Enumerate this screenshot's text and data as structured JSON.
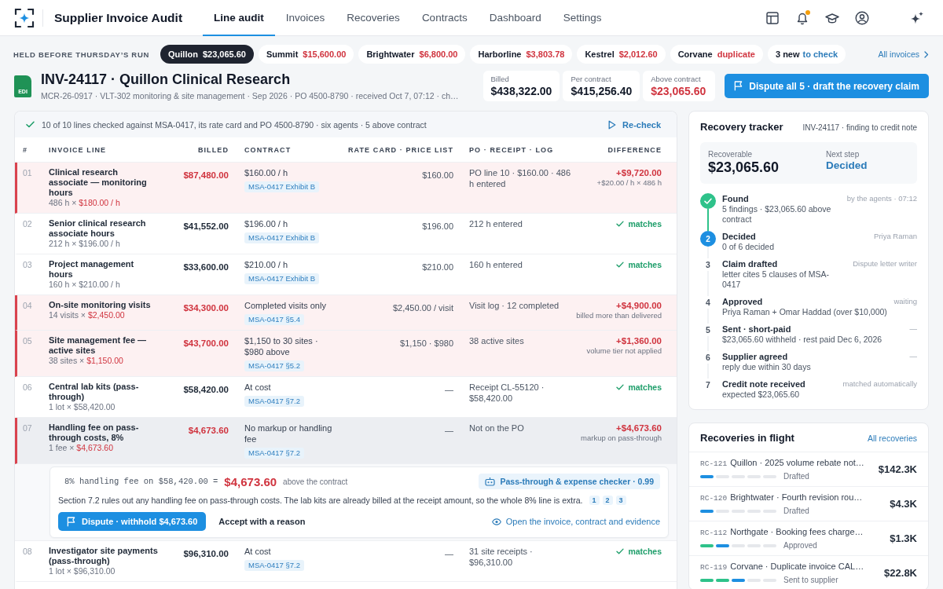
{
  "nav": {
    "title": "Supplier Invoice Audit",
    "tabs": [
      {
        "label": "Line audit",
        "selected": true
      },
      {
        "label": "Invoices",
        "selected": false
      },
      {
        "label": "Recoveries",
        "selected": false
      },
      {
        "label": "Contracts",
        "selected": false
      },
      {
        "label": "Dashboard",
        "selected": false
      },
      {
        "label": "Settings",
        "selected": false
      }
    ],
    "unread_alerts": true
  },
  "held": {
    "label": "HELD BEFORE THURSDAY’S RUN",
    "chips": [
      {
        "vendor": "Quillon",
        "amount": "$23,065.60",
        "selected": true
      },
      {
        "vendor": "Summit",
        "amount": "$15,600.00",
        "selected": false
      },
      {
        "vendor": "Brightwater",
        "amount": "$6,800.00",
        "selected": false
      },
      {
        "vendor": "Harborline",
        "amount": "$3,803.78",
        "selected": false
      },
      {
        "vendor": "Kestrel",
        "amount": "$2,012.60",
        "selected": false
      },
      {
        "vendor": "Corvane",
        "amount": "duplicate",
        "selected": false
      }
    ],
    "new_items": {
      "count": "3 new",
      "action": "to check"
    },
    "link": "All invoices"
  },
  "invoice": {
    "format": "EDI",
    "title": "INV-24117 · Quillon Clinical Research",
    "details": "MCR-26-0917 · VLT-302 monitoring & site management · Sep 2026 · PO 4500-8790 · received Oct 7, 07:12 · ch…",
    "stats": [
      {
        "label": "Billed",
        "value": "$438,322.00",
        "alert": false
      },
      {
        "label": "Per contract",
        "value": "$415,256.40",
        "alert": false
      },
      {
        "label": "Above contract",
        "value": "$23,065.60",
        "alert": true
      }
    ],
    "action": "Dispute all 5 · draft the recovery claim"
  },
  "audit": {
    "summary": "10 of 10 lines checked against MSA-0417, its rate card and PO 4500-8790 · six agents · 5 above contract",
    "recheck": "Re-check",
    "columns": [
      "#",
      "INVOICE LINE",
      "BILLED",
      "CONTRACT",
      "RATE CARD · PRICE LIST",
      "PO · RECEIPT · LOG",
      "DIFFERENCE"
    ],
    "lines": [
      {
        "number": "01",
        "name": "Clinical research associate — monitoring hours",
        "quantity": "486 h ×",
        "rate": "$180.00 / h",
        "billed": "$87,480.00",
        "contract": "$160.00 / h",
        "clause": "MSA-0417 Exhibit B",
        "rate_card": "$160.00",
        "evidence": "PO line 10 · $160.00 · 486 h entered",
        "flagged": true,
        "selected": false,
        "difference": {
          "kind": "above",
          "amount": "+$9,720.00",
          "note": "+$20.00 / h × 486 h"
        }
      },
      {
        "number": "02",
        "name": "Senior clinical research associate hours",
        "quantity": "212 h ×",
        "rate": "$196.00 / h",
        "billed": "$41,552.00",
        "contract": "$196.00 / h",
        "clause": "MSA-0417 Exhibit B",
        "rate_card": "$196.00",
        "evidence": "212 h entered",
        "flagged": false,
        "selected": false,
        "difference": {
          "kind": "match",
          "label": "matches"
        }
      },
      {
        "number": "03",
        "name": "Project management hours",
        "quantity": "160 h ×",
        "rate": "$210.00 / h",
        "billed": "$33,600.00",
        "contract": "$210.00 / h",
        "clause": "MSA-0417 Exhibit B",
        "rate_card": "$210.00",
        "evidence": "160 h entered",
        "flagged": false,
        "selected": false,
        "difference": {
          "kind": "match",
          "label": "matches"
        }
      },
      {
        "number": "04",
        "name": "On-site monitoring visits",
        "quantity": "14 visits ×",
        "rate": "$2,450.00",
        "billed": "$34,300.00",
        "contract": "Completed visits only",
        "clause": "MSA-0417 §5.4",
        "rate_card": "$2,450.00 / visit",
        "evidence": "Visit log · 12 completed",
        "flagged": true,
        "selected": false,
        "difference": {
          "kind": "above",
          "amount": "+$4,900.00",
          "note": "billed more than delivered"
        }
      },
      {
        "number": "05",
        "name": "Site management fee — active sites",
        "quantity": "38 sites ×",
        "rate": "$1,150.00",
        "billed": "$43,700.00",
        "contract": "$1,150 to 30 sites · $980 above",
        "clause": "MSA-0417 §5.2",
        "rate_card": "$1,150 · $980",
        "evidence": "38 active sites",
        "flagged": true,
        "selected": false,
        "difference": {
          "kind": "above",
          "amount": "+$1,360.00",
          "note": "volume tier not applied"
        }
      },
      {
        "number": "06",
        "name": "Central lab kits (pass-through)",
        "quantity": "1 lot ×",
        "rate": "$58,420.00",
        "billed": "$58,420.00",
        "contract": "At cost",
        "clause": "MSA-0417 §7.2",
        "rate_card": "—",
        "evidence": "Receipt CL-55120 · $58,420.00",
        "flagged": false,
        "selected": false,
        "difference": {
          "kind": "match",
          "label": "matches"
        }
      },
      {
        "number": "07",
        "name": "Handling fee on pass-through costs, 8%",
        "quantity": "1 fee ×",
        "rate": "$4,673.60",
        "billed": "$4,673.60",
        "contract": "No markup or handling fee",
        "clause": "MSA-0417 §7.2",
        "rate_card": "—",
        "evidence": "Not on the PO",
        "flagged": true,
        "selected": true,
        "difference": {
          "kind": "above",
          "amount": "+$4,673.60",
          "note": "markup on pass-through"
        },
        "detail": {
          "formula": "8% handling fee on $58,420.00 =",
          "amount": "$4,673.60",
          "note": "above the contract",
          "agent": "Pass-through & expense checker · 0.99",
          "explanation": "Section 7.2 rules out any handling fee on pass-through costs. The lab kits are already billed at the receipt amount, so the whole 8% line is extra.",
          "citations": [
            "1",
            "2",
            "3"
          ],
          "dispute": "Dispute · withhold $4,673.60",
          "accept": "Accept with a reason",
          "evidence_link": "Open the invoice, contract and evidence"
        }
      },
      {
        "number": "08",
        "name": "Investigator site payments (pass-through)",
        "quantity": "1 lot ×",
        "rate": "$96,310.00",
        "billed": "$96,310.00",
        "contract": "At cost",
        "clause": "MSA-0417 §7.2",
        "rate_card": "—",
        "evidence": "31 site receipts · $96,310.00",
        "flagged": false,
        "selected": false,
        "difference": {
          "kind": "match",
          "label": "matches"
        }
      }
    ]
  },
  "tracker": {
    "title": "Recovery tracker",
    "subtitle": "INV-24117 · finding to credit note",
    "recoverable_label": "Recoverable",
    "recoverable": "$23,065.60",
    "next_label": "Next step",
    "next": "Decided",
    "steps": [
      {
        "done": true,
        "current": false,
        "title": "Found",
        "detail": "5 findings · $23,065.60 above contract",
        "meta": "by the agents · 07:12"
      },
      {
        "done": false,
        "current": true,
        "number": "2",
        "title": "Decided",
        "detail": "0 of 6 decided",
        "meta": "Priya Raman"
      },
      {
        "done": false,
        "current": false,
        "number": "3",
        "title": "Claim drafted",
        "detail": "letter cites 5 clauses of MSA-0417",
        "meta": "Dispute letter writer"
      },
      {
        "done": false,
        "current": false,
        "number": "4",
        "title": "Approved",
        "detail": "Priya Raman + Omar Haddad (over $10,000)",
        "meta": "waiting"
      },
      {
        "done": false,
        "current": false,
        "number": "5",
        "title": "Sent · short-paid",
        "detail": "$23,065.60 withheld · rest paid Dec 6, 2026",
        "meta": "—"
      },
      {
        "done": false,
        "current": false,
        "number": "6",
        "title": "Supplier agreed",
        "detail": "reply due within 30 days",
        "meta": "—"
      },
      {
        "done": false,
        "current": false,
        "number": "7",
        "title": "Credit note received",
        "detail": "expected $23,065.60",
        "meta": "matched automatically"
      }
    ]
  },
  "recoveries": {
    "title": "Recoveries in flight",
    "link": "All recoveries",
    "items": [
      {
        "id": "RC-121",
        "title": "Quillon · 2025 volume rebate not…",
        "segments": [
          {
            "done": false,
            "current": true
          },
          {
            "done": false,
            "current": false
          },
          {
            "done": false,
            "current": false
          },
          {
            "done": false,
            "current": false
          },
          {
            "done": false,
            "current": false
          }
        ],
        "status": "Drafted",
        "amount": "$142.3K"
      },
      {
        "id": "RC-120",
        "title": "Brightwater · Fourth revision rou…",
        "segments": [
          {
            "done": false,
            "current": true
          },
          {
            "done": false,
            "current": false
          },
          {
            "done": false,
            "current": false
          },
          {
            "done": false,
            "current": false
          },
          {
            "done": false,
            "current": false
          }
        ],
        "status": "Drafted",
        "amount": "$4.3K"
      },
      {
        "id": "RC-112",
        "title": "Northgate · Booking fees charge…",
        "segments": [
          {
            "done": true,
            "current": false
          },
          {
            "done": false,
            "current": true
          },
          {
            "done": false,
            "current": false
          },
          {
            "done": false,
            "current": false
          },
          {
            "done": false,
            "current": false
          }
        ],
        "status": "Approved",
        "amount": "$1.3K"
      },
      {
        "id": "RC-119",
        "title": "Corvane · Duplicate invoice CAL…",
        "segments": [
          {
            "done": true,
            "current": false
          },
          {
            "done": true,
            "current": false
          },
          {
            "done": false,
            "current": true
          },
          {
            "done": false,
            "current": false
          },
          {
            "done": false,
            "current": false
          }
        ],
        "status": "Sent to supplier",
        "amount": "$22.8K"
      }
    ]
  }
}
